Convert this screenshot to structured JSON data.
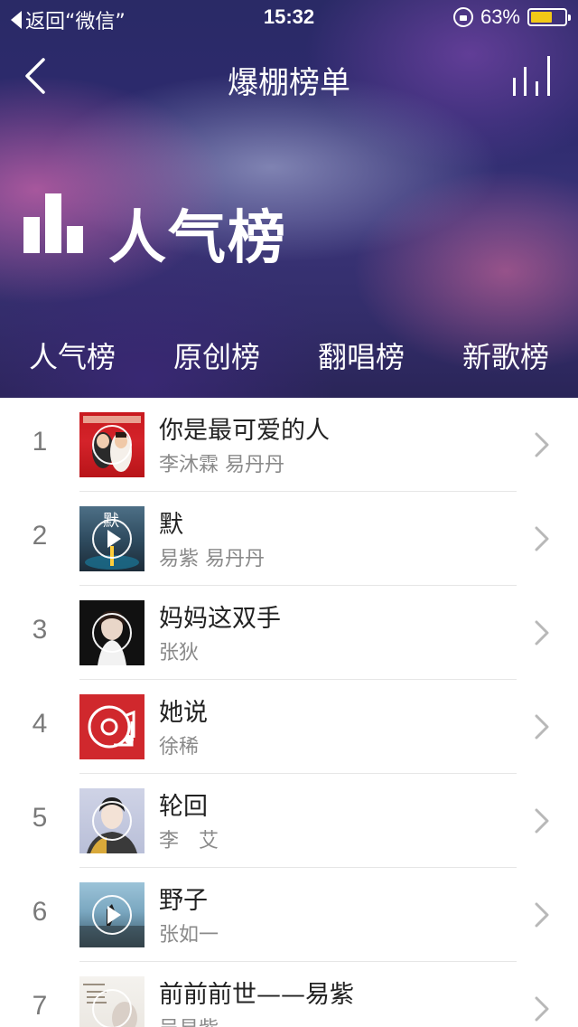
{
  "status_bar": {
    "back_text": "返回“微信”",
    "time": "15:32",
    "battery": "63%",
    "battery_level": 0.63,
    "battery_color": "#f2c817"
  },
  "nav": {
    "title": "爆棚榜单",
    "back_icon": "chevron-left-icon",
    "chart_icon": "bar-chart-icon"
  },
  "hero": {
    "title": "人气榜",
    "logo_icon": "bar-chart-logo-icon"
  },
  "tabs": [
    {
      "label": "人气榜"
    },
    {
      "label": "原创榜"
    },
    {
      "label": "翻唱榜"
    },
    {
      "label": "新歌榜"
    }
  ],
  "songs": [
    {
      "rank": "1",
      "title": "你是最可爱的人",
      "artist": "李沐霖 易丹丹"
    },
    {
      "rank": "2",
      "title": "默",
      "artist": "易紫 易丹丹"
    },
    {
      "rank": "3",
      "title": "妈妈这双手",
      "artist": "张狄"
    },
    {
      "rank": "4",
      "title": "她说",
      "artist": "徐稀"
    },
    {
      "rank": "5",
      "title": "轮回",
      "artist": "李　艾"
    },
    {
      "rank": "6",
      "title": "野子",
      "artist": "张如一"
    },
    {
      "rank": "7",
      "title": "前前前世——易紫",
      "artist": "吴易紫"
    }
  ],
  "cover_texts": {
    "cover2": "默"
  }
}
